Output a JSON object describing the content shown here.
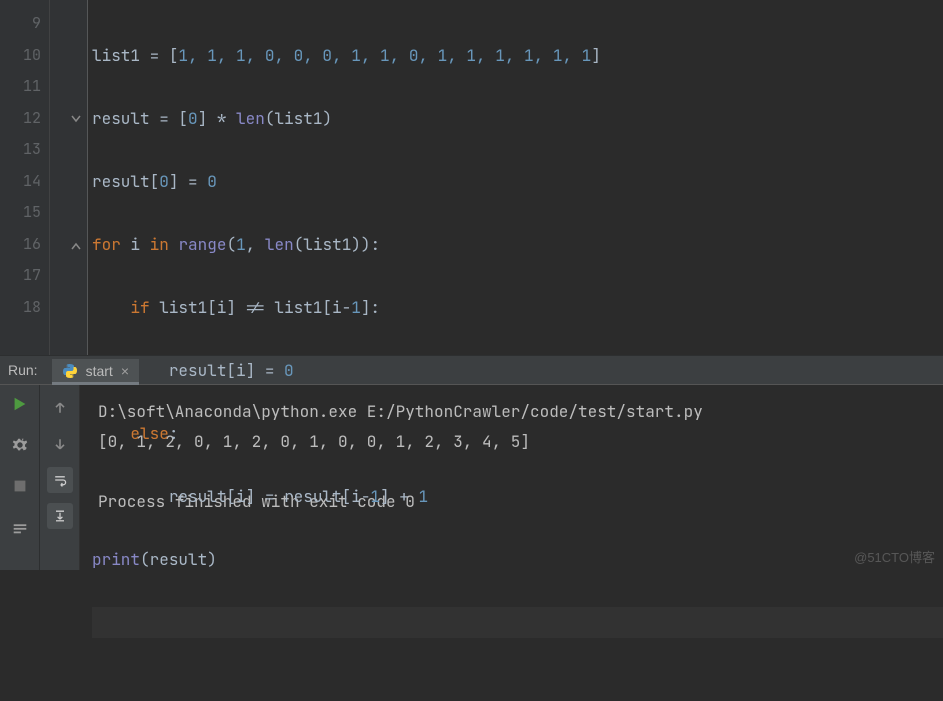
{
  "gutter": {
    "start": 9,
    "end": 18
  },
  "code": {
    "l9": {
      "a": "list1 = [",
      "b": "1",
      "c": ", ",
      "vals": "1, 1, 1, 0, 0, 0, 1, 1, 0, 1, 1, 1, 1, 1, 1",
      "d": "]"
    },
    "l10": {
      "a": "result = [",
      "b": "0",
      "c": "] * ",
      "fn": "len",
      "d": "(list1)"
    },
    "l11": {
      "a": "result[",
      "b": "0",
      "c": "] = ",
      "d": "0"
    },
    "l12": {
      "kw1": "for",
      "a": " i ",
      "kw2": "in",
      "b": " ",
      "fn": "range",
      "c": "(",
      "n1": "1",
      "d": ", ",
      "fn2": "len",
      "e": "(list1)):"
    },
    "l13": {
      "kw": "if",
      "a": " list1[i] != list1[i-",
      "n": "1",
      "b": "]:"
    },
    "l14": {
      "a": "result[i] = ",
      "n": "0"
    },
    "l15": {
      "kw": "else",
      "a": ":"
    },
    "l16": {
      "a": "result[i] = result[i-",
      "n1": "1",
      "b": "] + ",
      "n2": "1"
    },
    "l17": {
      "fn": "print",
      "a": "(result)"
    }
  },
  "run": {
    "label": "Run:",
    "tab": "start",
    "console_line1": "D:\\soft\\Anaconda\\python.exe E:/PythonCrawler/code/test/start.py",
    "console_line2": "[0, 1, 2, 0, 1, 2, 0, 1, 0, 0, 1, 2, 3, 4, 5]",
    "console_line3": "",
    "console_line4": "Process finished with exit code 0"
  },
  "watermark": "@51CTO博客"
}
